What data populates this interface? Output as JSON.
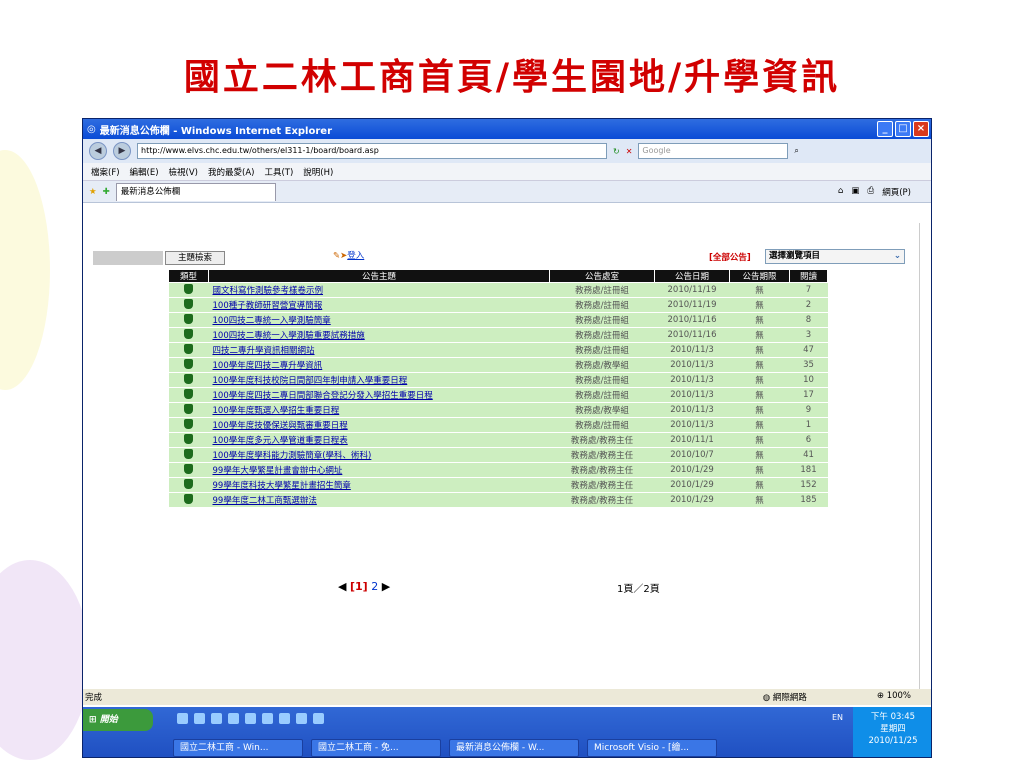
{
  "slide_title": "國立二林工商首頁/學生園地/升學資訊",
  "window": {
    "title": "最新消息公佈欄 - Windows Internet Explorer",
    "url": "http://www.elvs.chc.edu.tw/others/el311-1/board/board.asp",
    "search_placeholder": "Google",
    "menu": [
      "檔案(F)",
      "編輯(E)",
      "檢視(V)",
      "我的最愛(A)",
      "工具(T)",
      "說明(H)"
    ],
    "tab_label": "最新消息公佈欄",
    "page_menu": "網頁(P)"
  },
  "board": {
    "topic_search": "主題檢索",
    "login": "登入",
    "all_notice": "[全部公告]",
    "browse_select": "選擇瀏覽項目",
    "headers": [
      "類型",
      "公告主題",
      "公告處室",
      "公告日期",
      "公告期限",
      "閱讀"
    ],
    "rows": [
      [
        "國文科寫作測驗參考樣卷示例",
        "教務處/註冊組",
        "2010/11/19",
        "無",
        "7"
      ],
      [
        "100種子教師研習營宣導簡報",
        "教務處/註冊組",
        "2010/11/19",
        "無",
        "2"
      ],
      [
        "100四技二專統一入學測驗簡章",
        "教務處/註冊組",
        "2010/11/16",
        "無",
        "8"
      ],
      [
        "100四技二專統一入學測驗重要試務措施",
        "教務處/註冊組",
        "2010/11/16",
        "無",
        "3"
      ],
      [
        "四技二專升學資訊相關網站",
        "教務處/註冊組",
        "2010/11/3",
        "無",
        "47"
      ],
      [
        "100學年度四技二專升學資訊",
        "教務處/教學組",
        "2010/11/3",
        "無",
        "35"
      ],
      [
        "100學年度科技校院日間部四年制申請入學重要日程",
        "教務處/註冊組",
        "2010/11/3",
        "無",
        "10"
      ],
      [
        "100學年度四技二專日間部聯合登記分發入學招生重要日程",
        "教務處/註冊組",
        "2010/11/3",
        "無",
        "17"
      ],
      [
        "100學年度甄選入學招生重要日程",
        "教務處/教學組",
        "2010/11/3",
        "無",
        "9"
      ],
      [
        "100學年度技優保送與甄審重要日程",
        "教務處/註冊組",
        "2010/11/3",
        "無",
        "1"
      ],
      [
        "100學年度多元入學管道重要日程表",
        "教務處/教務主任",
        "2010/11/1",
        "無",
        "6"
      ],
      [
        "100學年度學科能力測驗簡章(學科、術科)",
        "教務處/教務主任",
        "2010/10/7",
        "無",
        "41"
      ],
      [
        "99學年大學繁星計畫會辦中心網址",
        "教務處/教務主任",
        "2010/1/29",
        "無",
        "181"
      ],
      [
        "99學年度科技大學繁星計畫招生簡章",
        "教務處/教務主任",
        "2010/1/29",
        "無",
        "152"
      ],
      [
        "99學年度二林工商甄選辦法",
        "教務處/教務主任",
        "2010/1/29",
        "無",
        "185"
      ]
    ],
    "page_current": "[1]",
    "page_next": "2",
    "page_count": "1頁／2頁"
  },
  "status": {
    "left": "完成",
    "zone": "網際網路",
    "zoom": "100%"
  },
  "taskbar": {
    "start": "開始",
    "lang": "EN",
    "tasks": [
      "國立二林工商 - Win...",
      "國立二林工商 - 免...",
      "最新消息公佈欄 - W...",
      "Microsoft Visio - [繪..."
    ],
    "time": "下午 03:45",
    "weekday": "星期四",
    "date": "2010/11/25"
  }
}
